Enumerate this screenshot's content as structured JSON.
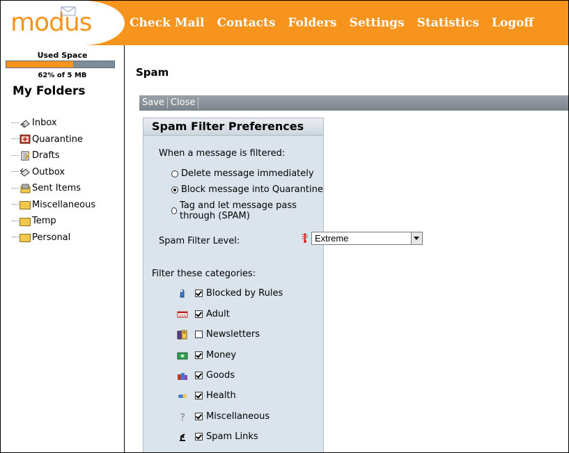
{
  "app": {
    "logo": "modus"
  },
  "nav": [
    "Check Mail",
    "Contacts",
    "Folders",
    "Settings",
    "Statistics",
    "Logoff"
  ],
  "quota": {
    "title": "Used Space",
    "text": "62% of 5 MB",
    "fraction": 0.62
  },
  "sidebar": {
    "title": "My Folders",
    "folders": [
      {
        "label": "Inbox",
        "icon": "inbox-icon"
      },
      {
        "label": "Quarantine",
        "icon": "quarantine-icon"
      },
      {
        "label": "Drafts",
        "icon": "drafts-icon"
      },
      {
        "label": "Outbox",
        "icon": "outbox-icon"
      },
      {
        "label": "Sent Items",
        "icon": "sent-items-icon"
      },
      {
        "label": "Miscellaneous",
        "icon": "folder-icon"
      },
      {
        "label": "Temp",
        "icon": "folder-icon"
      },
      {
        "label": "Personal",
        "icon": "folder-icon"
      }
    ]
  },
  "main": {
    "title": "Spam",
    "toolbar": {
      "save": "Save",
      "close": "Close"
    },
    "panel": {
      "title": "Spam Filter Preferences",
      "filtered_label": "When a message is filtered:",
      "options": [
        {
          "label": "Delete message immediately",
          "selected": false
        },
        {
          "label": "Block message into Quarantine",
          "selected": true
        },
        {
          "label": "Tag and let message pass through (SPAM)",
          "selected": false
        }
      ],
      "level_label": "Spam Filter Level:",
      "level_value": "Extreme",
      "categories_label": "Filter these categories:",
      "categories": [
        {
          "label": "Blocked by Rules",
          "checked": true,
          "icon": "blocked-rules-icon"
        },
        {
          "label": "Adult",
          "checked": true,
          "icon": "adult-icon"
        },
        {
          "label": "Newsletters",
          "checked": false,
          "icon": "newsletters-icon"
        },
        {
          "label": "Money",
          "checked": true,
          "icon": "money-icon"
        },
        {
          "label": "Goods",
          "checked": true,
          "icon": "goods-icon"
        },
        {
          "label": "Health",
          "checked": true,
          "icon": "health-icon"
        },
        {
          "label": "Miscellaneous",
          "checked": true,
          "icon": "question-icon"
        },
        {
          "label": "Spam Links",
          "checked": true,
          "icon": "spam-links-icon"
        }
      ]
    }
  },
  "colors": {
    "accent": "#f7941e",
    "toolbar": "#8a9198",
    "panel": "#dbe4ec"
  }
}
